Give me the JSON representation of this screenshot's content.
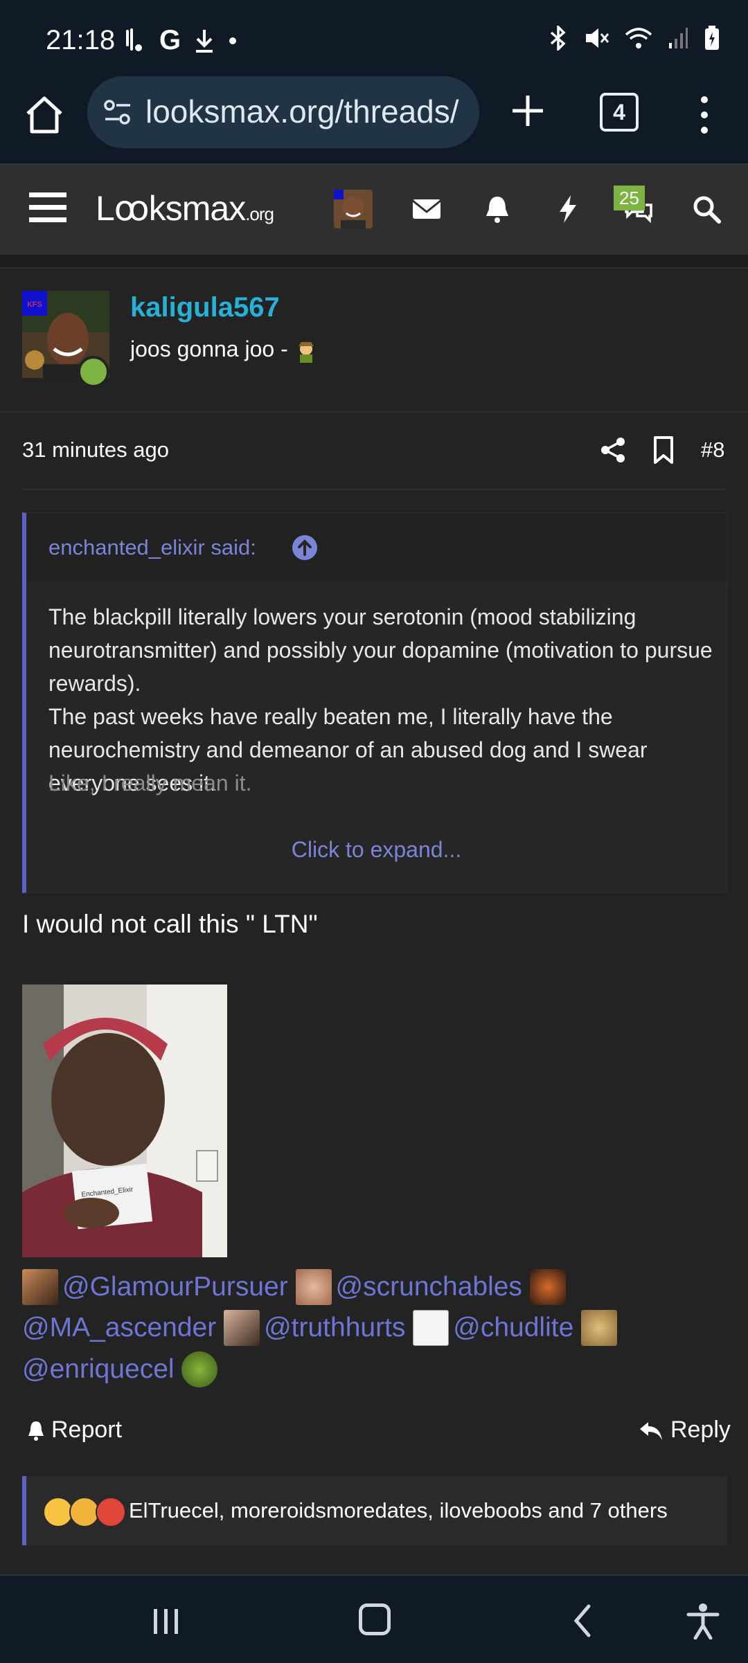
{
  "status_bar": {
    "time": "21:18",
    "left_icons": [
      "vibration-icon",
      "google-icon",
      "download-icon",
      "dot-icon"
    ],
    "right_icons": [
      "bluetooth-icon",
      "mute-icon",
      "wifi-icon",
      "signal-icon",
      "battery-icon"
    ],
    "google_label": "G"
  },
  "browser": {
    "url": "looksmax.org/threads/",
    "tab_count": "4"
  },
  "site_header": {
    "logo_main": "Lꝏksmax",
    "logo_suffix": ".org",
    "notification_badge": "25"
  },
  "post": {
    "author": "kaligula567",
    "author_title": "joos gonna joo -",
    "avatar_tag": "KFS",
    "timestamp": "31 minutes ago",
    "post_number": "#8",
    "quote": {
      "attribution": "enchanted_elixir said:",
      "paragraphs": [
        "The blackpill literally lowers your serotonin (mood stabilizing neurotransmitter) and possibly your dopamine (motivation to pursue rewards).",
        "The past weeks have really beaten me, I literally have the neurochemistry and demeanor of an abused dog and I swear everyone sees it."
      ],
      "faded_line": "Like, I really mean it.",
      "expand_label": "Click to expand..."
    },
    "body_text": "I would not call this \" LTN\"",
    "mentions": [
      "@GlamourPursuer",
      "@scrunchables",
      "@MA_ascender",
      "@truthhurts",
      "@chudlite",
      "@enriquecel"
    ],
    "report_label": "Report",
    "reply_label": "Reply",
    "reactions_text": "ElTruecel, moreroidsmoredates, iloveboobs and 7 others"
  },
  "colors": {
    "accent": "#5b64c6",
    "link": "#6d75d5",
    "username": "#27b1d6",
    "online": "#7cb342",
    "background": "#232323"
  }
}
